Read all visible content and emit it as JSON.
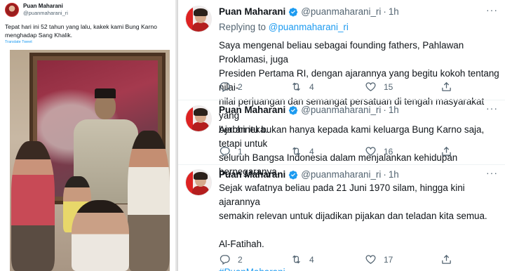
{
  "left_tweet": {
    "name": "Puan Maharani",
    "handle": "@puanmaharani_ri",
    "text": "Tepat hari ini 52 tahun yang lalu, kakek kami Bung Karno menghadap Sang Khalik.",
    "translate": "Translate Tweet"
  },
  "thread": [
    {
      "name": "Puan Maharani",
      "handle": "@puanmaharani_ri",
      "dot": "·",
      "time": "1h",
      "reply_prefix": "",
      "reply_handle": "",
      "lines": [
        "Saya mengenal beliau sebagai founding fathers, Pahlawan Proklamasi, juga",
        "Presiden Pertama RI, dengan ajarannya yang begitu kokoh tentang nilai-",
        "nilai perjuangan dan semangat persatuan di tengah masyarakat yang",
        "berbhineka."
      ],
      "replies": "2",
      "retweets": "4",
      "likes": "15"
    },
    {
      "name": "Puan Maharani",
      "handle": "@puanmaharani_ri",
      "dot": "·",
      "time": "1h",
      "lines": [
        "Ajaran itu bukan hanya kepada kami keluarga Bung Karno saja, tetapi untuk",
        "seluruh Bangsa Indonesia dalam menjalankan kehidupan bernegaranya."
      ],
      "replies": "1",
      "retweets": "4",
      "likes": "16"
    },
    {
      "name": "Puan Maharani",
      "handle": "@puanmaharani_ri",
      "dot": "·",
      "time": "1h",
      "lines": [
        "Sejak wafatnya beliau pada 21 Juni 1970 silam, hingga kini ajarannya",
        "semakin relevan untuk dijadikan pijakan dan teladan kita semua.",
        "",
        "Al-Fatihah.",
        ""
      ],
      "hashtag": "#PuanMaharani",
      "replies": "2",
      "retweets": "4",
      "likes": "17"
    }
  ],
  "reply_label": "Replying to",
  "reply_handle": "@puanmaharani_ri",
  "more": "···",
  "colors": {
    "accent": "#1d9bf0",
    "text": "#0f1419",
    "muted": "#536471",
    "verified": "#1d9bf0"
  },
  "icons": [
    "reply-icon",
    "retweet-icon",
    "like-icon",
    "share-icon",
    "verified-icon",
    "more-icon"
  ]
}
